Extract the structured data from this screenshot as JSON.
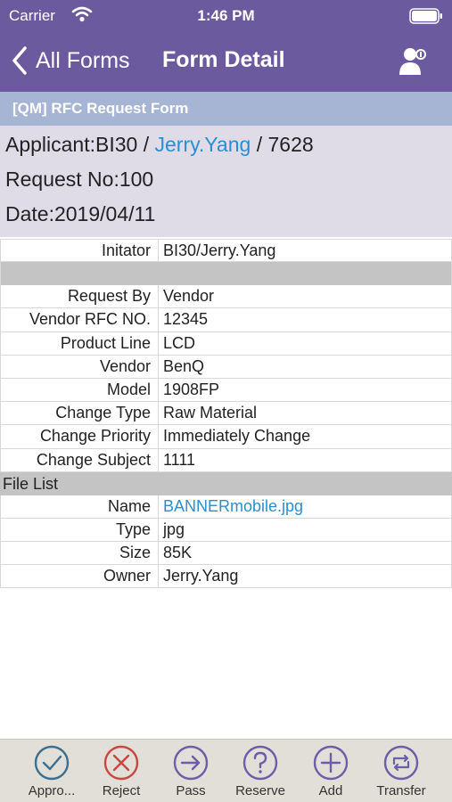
{
  "status_bar": {
    "carrier": "Carrier",
    "time": "1:46 PM"
  },
  "navbar": {
    "back_label": "All Forms",
    "title": "Form Detail",
    "user_icon": "user-settings-icon"
  },
  "form": {
    "title": "[QM] RFC Request Form"
  },
  "summary": {
    "applicant_prefix": "Applicant:BI30 / ",
    "applicant_name": "Jerry.Yang",
    "applicant_suffix": " / 7628",
    "request_no": "Request No:100",
    "date": "Date:2019/04/11"
  },
  "details": {
    "initiator": {
      "label": "Initator",
      "value": "BI30/Jerry.Yang"
    },
    "rows": [
      {
        "label": "Request By",
        "value": "Vendor"
      },
      {
        "label": "Vendor RFC NO.",
        "value": "12345"
      },
      {
        "label": "Product Line",
        "value": "LCD"
      },
      {
        "label": "Vendor",
        "value": "BenQ"
      },
      {
        "label": "Model",
        "value": "1908FP"
      },
      {
        "label": "Change Type",
        "value": "Raw Material"
      },
      {
        "label": "Change Priority",
        "value": "Immediately Change"
      },
      {
        "label": "Change Subject",
        "value": "1111"
      }
    ],
    "file_list_header": "File List",
    "file": {
      "name": {
        "label": "Name",
        "value": "BANNERmobile.jpg"
      },
      "type": {
        "label": "Type",
        "value": "jpg"
      },
      "size": {
        "label": "Size",
        "value": "85K"
      },
      "owner": {
        "label": "Owner",
        "value": "Jerry.Yang"
      }
    }
  },
  "toolbar": {
    "approve": "Appro...",
    "reject": "Reject",
    "pass": "Pass",
    "reserve": "Reserve",
    "add": "Add",
    "transfer": "Transfer"
  },
  "colors": {
    "header": "#6b5a9e",
    "form_title_bar": "#a6b5d3",
    "summary_bg": "#dfdce8",
    "link": "#2a8fd0",
    "approve": "#3c6e8f",
    "reject": "#c8473f",
    "toolbar_icon": "#6a5fa8"
  }
}
